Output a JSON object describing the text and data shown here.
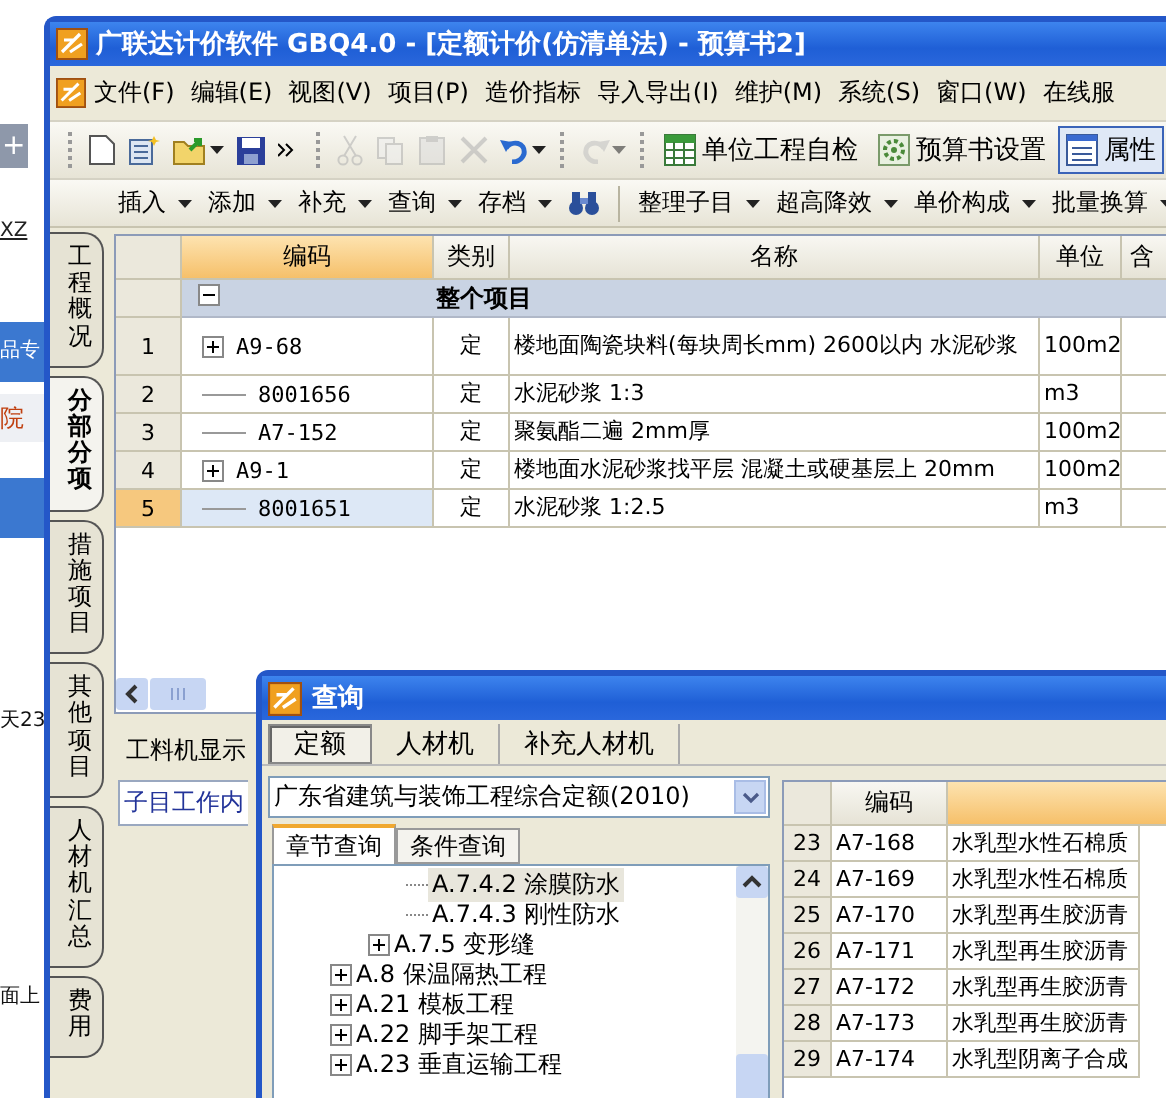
{
  "background_page": {
    "tab": "+",
    "link": "XZ",
    "banner": "品专",
    "red_text": "院",
    "fragment_1": "天23",
    "fragment_2": "面上"
  },
  "window": {
    "title": "广联达计价软件 GBQ4.0 - [定额计价(仿清单法) - 预算书2]"
  },
  "menu": [
    "文件(F)",
    "编辑(E)",
    "视图(V)",
    "项目(P)",
    "造价指标",
    "导入导出(I)",
    "维护(M)",
    "系统(S)",
    "窗口(W)",
    "在线服"
  ],
  "toolbar": {
    "icon_buttons": [
      {
        "kind": "new",
        "disabled": false
      },
      {
        "kind": "template",
        "disabled": false
      },
      {
        "kind": "open",
        "disabled": false,
        "dropdown": true
      },
      {
        "kind": "save",
        "disabled": false
      },
      {
        "kind": "more",
        "disabled": false
      },
      {
        "kind": "cut",
        "disabled": true
      },
      {
        "kind": "copy",
        "disabled": true
      },
      {
        "kind": "paste",
        "disabled": true
      },
      {
        "kind": "delete",
        "disabled": true
      },
      {
        "kind": "undo",
        "disabled": false,
        "dropdown": true
      },
      {
        "kind": "redo",
        "disabled": true,
        "dropdown": true
      }
    ],
    "text_buttons": [
      {
        "kind": "check",
        "label": "单位工程自检",
        "pressed": false
      },
      {
        "kind": "settings",
        "label": "预算书设置",
        "pressed": false
      },
      {
        "kind": "properties",
        "label": "属性",
        "pressed": true
      }
    ]
  },
  "edit_toolbar": {
    "group_1": [
      "插入",
      "添加",
      "补充",
      "查询",
      "存档"
    ],
    "group_2": [
      "整理子目",
      "超高降效",
      "单价构成",
      "批量换算"
    ]
  },
  "side_tabs": [
    {
      "label": "工程概况",
      "selected": false
    },
    {
      "label": "分部分项",
      "selected": true
    },
    {
      "label": "措施项目",
      "selected": false
    },
    {
      "label": "其他项目",
      "selected": false
    },
    {
      "label": "人材机汇总",
      "selected": false
    },
    {
      "label": "费用",
      "selected": false
    }
  ],
  "table": {
    "columns": [
      {
        "label": "编码",
        "active": true
      },
      {
        "label": "类别",
        "active": false
      },
      {
        "label": "名称",
        "active": false
      },
      {
        "label": "单位",
        "active": false
      },
      {
        "label": "含",
        "active": false
      }
    ],
    "rows": [
      {
        "kind": "group",
        "name": "整个项目",
        "expanded": true
      },
      {
        "kind": "item",
        "num": "1",
        "code": "A9-68",
        "expandable": true,
        "type": "定",
        "name": "楼地面陶瓷块料(每块周长mm) 2600以内 水泥砂浆",
        "unit": "100m2",
        "selected": false
      },
      {
        "kind": "item",
        "num": "2",
        "code": "8001656",
        "expandable": false,
        "type": "定",
        "name": "水泥砂浆 1:3",
        "unit": "m3",
        "selected": false
      },
      {
        "kind": "item",
        "num": "3",
        "code": "A7-152",
        "expandable": false,
        "type": "定",
        "name": "聚氨酯二遍 2mm厚",
        "unit": "100m2",
        "selected": false
      },
      {
        "kind": "item",
        "num": "4",
        "code": "A9-1",
        "expandable": true,
        "type": "定",
        "name": "楼地面水泥砂浆找平层 混凝土或硬基层上 20mm",
        "unit": "100m2",
        "selected": false
      },
      {
        "kind": "item",
        "num": "5",
        "code": "8001651",
        "expandable": false,
        "type": "定",
        "name": "水泥砂浆 1:2.5",
        "unit": "m3",
        "selected": true
      }
    ]
  },
  "lower_panel": {
    "title": "工料机显示",
    "tab": "子目工作内"
  },
  "dialog": {
    "title": "查询",
    "tabs": [
      {
        "label": "定额",
        "selected": true
      },
      {
        "label": "人材机",
        "selected": false
      },
      {
        "label": "补充人材机",
        "selected": false
      }
    ],
    "library": "广东省建筑与装饰工程综合定额(2010)",
    "search_tabs": [
      {
        "label": "章节查询",
        "selected": true
      },
      {
        "label": "条件查询",
        "selected": false
      }
    ],
    "tree": [
      {
        "children": [
          {
            "children": [
              {
                "label": "A.7.4.2 涂膜防水",
                "expandable": false,
                "selected": true
              },
              {
                "label": "A.7.4.3 刚性防水",
                "expandable": false,
                "selected": false
              }
            ]
          },
          {
            "label": "A.7.5 变形缝",
            "expandable": true,
            "selected": false
          }
        ]
      },
      {
        "label": "A.8 保温隔热工程",
        "expandable": true,
        "selected": false
      },
      {
        "label": "A.21 模板工程",
        "expandable": true,
        "selected": false
      },
      {
        "label": "A.22 脚手架工程",
        "expandable": true,
        "selected": false
      },
      {
        "label": "A.23 垂直运输工程",
        "expandable": true,
        "selected": false
      }
    ],
    "results": {
      "columns": [
        {
          "label": "编码"
        }
      ],
      "rows": [
        {
          "num": "23",
          "code": "A7-168",
          "name": "水乳型水性石棉质"
        },
        {
          "num": "24",
          "code": "A7-169",
          "name": "水乳型水性石棉质"
        },
        {
          "num": "25",
          "code": "A7-170",
          "name": "水乳型再生胶沥青"
        },
        {
          "num": "26",
          "code": "A7-171",
          "name": "水乳型再生胶沥青"
        },
        {
          "num": "27",
          "code": "A7-172",
          "name": "水乳型再生胶沥青"
        },
        {
          "num": "28",
          "code": "A7-173",
          "name": "水乳型再生胶沥青"
        },
        {
          "num": "29",
          "code": "A7-174",
          "name": "水乳型阴离子合成"
        }
      ]
    }
  }
}
